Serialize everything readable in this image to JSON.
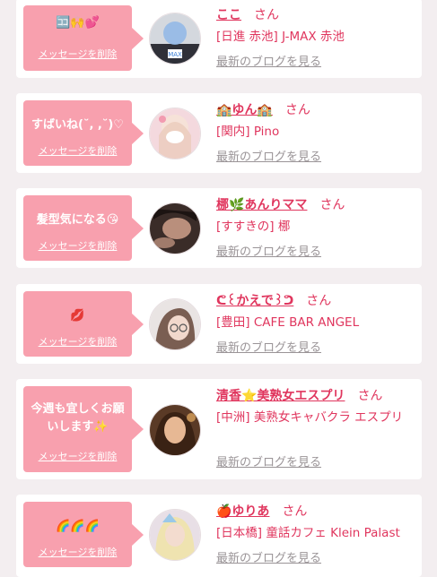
{
  "delete_label": "メッセージを削除",
  "blog_label": "最新のブログを見る",
  "san_label": "さん",
  "items": [
    {
      "message": "🈁🙌💕",
      "name": "ここ",
      "shop": "[日進 赤池] J-MAX 赤池",
      "avatar_desc": "girl-avatar-blurred"
    },
    {
      "message": "すばいね(˘, ,˘)♡",
      "name": "🏫ゆん🏫",
      "shop": "[関内] Pino",
      "avatar_desc": "girl-avatar-pink"
    },
    {
      "message": "髪型気になる😘",
      "name": "梛🌿あんりママ",
      "shop": "[すすきの] 梛",
      "avatar_desc": "girl-avatar-dark"
    },
    {
      "message": "💋",
      "name": "ᕦ꒰かえで꒱ᕤ",
      "shop": "[豊田] CAFE BAR ANGEL",
      "avatar_desc": "girl-avatar-glasses"
    },
    {
      "message": "今週も宜しくお願いします✨",
      "name": "清香⭐美熟女エスプリ",
      "shop": "[中洲] 美熟女キャバクラ エスプリ",
      "avatar_desc": "girl-avatar-warm"
    },
    {
      "message": "🌈🌈🌈",
      "name": "🍎ゆりあ",
      "shop": "[日本橋] 童話カフェ Klein Palast",
      "avatar_desc": "girl-avatar-blonde"
    }
  ],
  "colors": {
    "accent": "#e0365e",
    "bubble": "#f8a0ae",
    "background": "#f3eef0",
    "muted": "#9a9497"
  }
}
